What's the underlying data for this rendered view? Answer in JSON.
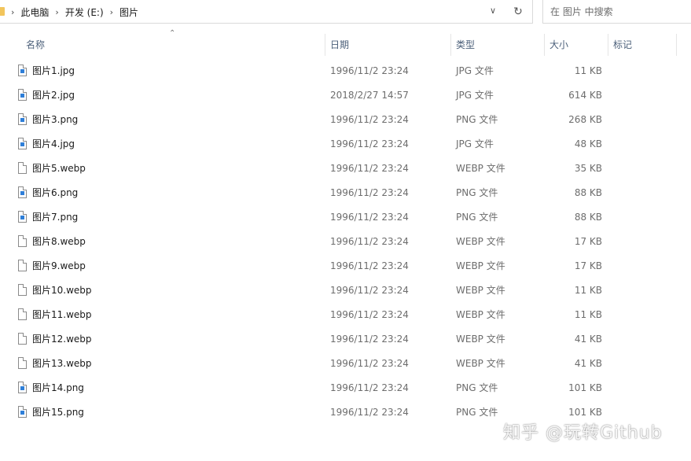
{
  "breadcrumb": {
    "items": [
      "此电脑",
      "开发 (E:)",
      "图片"
    ],
    "separator": "›"
  },
  "addressbar": {
    "dropdown_icon": "chevron-down-icon",
    "refresh_icon": "refresh-icon"
  },
  "search": {
    "placeholder": "在 图片 中搜索"
  },
  "columns": {
    "name": "名称",
    "date": "日期",
    "type": "类型",
    "size": "大小",
    "tags": "标记"
  },
  "files": [
    {
      "name": "图片1.jpg",
      "date": "1996/11/2 23:24",
      "type": "JPG 文件",
      "size": "11 KB",
      "icon": "image-file-icon"
    },
    {
      "name": "图片2.jpg",
      "date": "2018/2/27 14:57",
      "type": "JPG 文件",
      "size": "614 KB",
      "icon": "image-file-icon"
    },
    {
      "name": "图片3.png",
      "date": "1996/11/2 23:24",
      "type": "PNG 文件",
      "size": "268 KB",
      "icon": "image-file-icon"
    },
    {
      "name": "图片4.jpg",
      "date": "1996/11/2 23:24",
      "type": "JPG 文件",
      "size": "48 KB",
      "icon": "image-file-icon"
    },
    {
      "name": "图片5.webp",
      "date": "1996/11/2 23:24",
      "type": "WEBP 文件",
      "size": "35 KB",
      "icon": "file-icon"
    },
    {
      "name": "图片6.png",
      "date": "1996/11/2 23:24",
      "type": "PNG 文件",
      "size": "88 KB",
      "icon": "image-file-icon"
    },
    {
      "name": "图片7.png",
      "date": "1996/11/2 23:24",
      "type": "PNG 文件",
      "size": "88 KB",
      "icon": "image-file-icon"
    },
    {
      "name": "图片8.webp",
      "date": "1996/11/2 23:24",
      "type": "WEBP 文件",
      "size": "17 KB",
      "icon": "file-icon"
    },
    {
      "name": "图片9.webp",
      "date": "1996/11/2 23:24",
      "type": "WEBP 文件",
      "size": "17 KB",
      "icon": "file-icon"
    },
    {
      "name": "图片10.webp",
      "date": "1996/11/2 23:24",
      "type": "WEBP 文件",
      "size": "11 KB",
      "icon": "file-icon"
    },
    {
      "name": "图片11.webp",
      "date": "1996/11/2 23:24",
      "type": "WEBP 文件",
      "size": "11 KB",
      "icon": "file-icon"
    },
    {
      "name": "图片12.webp",
      "date": "1996/11/2 23:24",
      "type": "WEBP 文件",
      "size": "41 KB",
      "icon": "file-icon"
    },
    {
      "name": "图片13.webp",
      "date": "1996/11/2 23:24",
      "type": "WEBP 文件",
      "size": "41 KB",
      "icon": "file-icon"
    },
    {
      "name": "图片14.png",
      "date": "1996/11/2 23:24",
      "type": "PNG 文件",
      "size": "101 KB",
      "icon": "image-file-icon"
    },
    {
      "name": "图片15.png",
      "date": "1996/11/2 23:24",
      "type": "PNG 文件",
      "size": "101 KB",
      "icon": "image-file-icon"
    }
  ],
  "watermark": "知乎 @玩转Github",
  "colors": {
    "header_text": "#4c607a",
    "secondary_text": "#6d6d6d",
    "image_icon_accent": "#2f7fd8",
    "folder_icon": "#f2c55c"
  }
}
